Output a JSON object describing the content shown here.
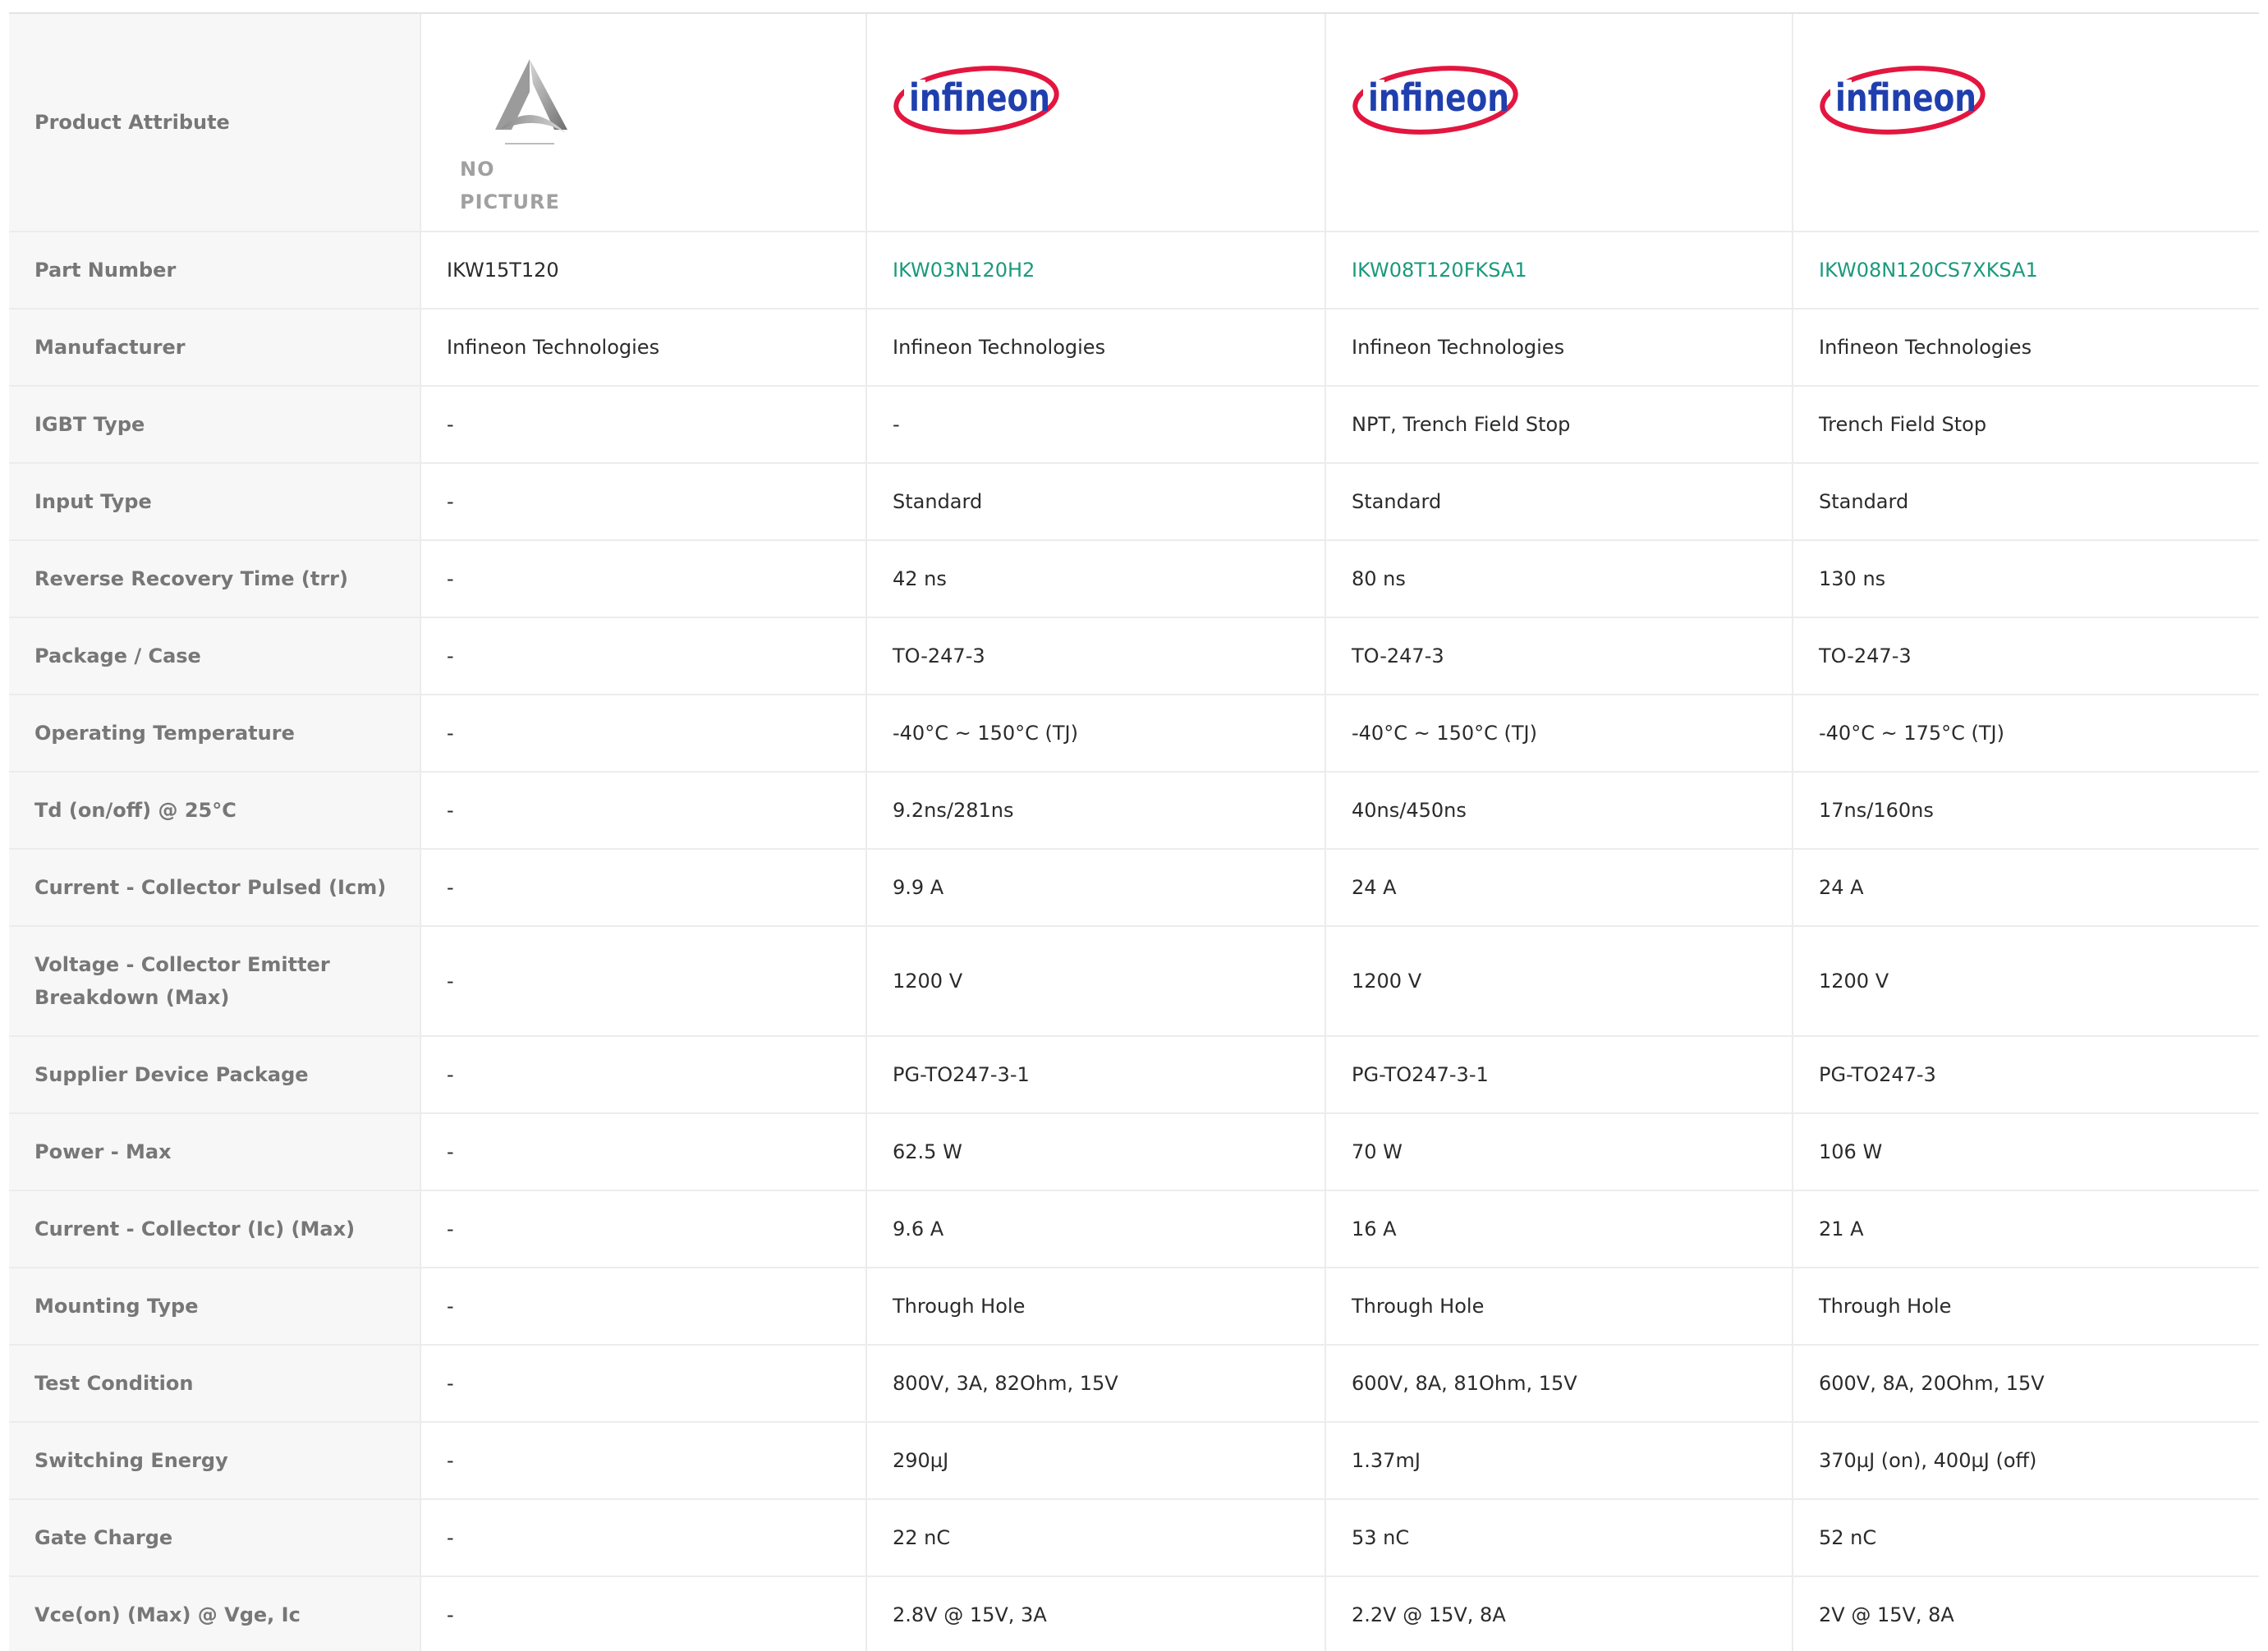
{
  "table": {
    "header_label": "Product Attribute",
    "no_picture_text": "NO PICTURE",
    "logo_text": "infineon",
    "columns": [
      {
        "image": "no-picture",
        "is_link": false
      },
      {
        "image": "infineon-logo",
        "is_link": true
      },
      {
        "image": "infineon-logo",
        "is_link": true
      },
      {
        "image": "infineon-logo",
        "is_link": true
      }
    ],
    "rows": [
      {
        "label": "Part Number",
        "values": [
          "IKW15T120",
          "IKW03N120H2",
          "IKW08T120FKSA1",
          "IKW08N120CS7XKSA1"
        ]
      },
      {
        "label": "Manufacturer",
        "values": [
          "Infineon Technologies",
          "Infineon Technologies",
          "Infineon Technologies",
          "Infineon Technologies"
        ]
      },
      {
        "label": "IGBT Type",
        "values": [
          "-",
          "-",
          "NPT, Trench Field Stop",
          "Trench Field Stop"
        ]
      },
      {
        "label": "Input Type",
        "values": [
          "-",
          "Standard",
          "Standard",
          "Standard"
        ]
      },
      {
        "label": "Reverse Recovery Time (trr)",
        "values": [
          "-",
          "42 ns",
          "80 ns",
          "130 ns"
        ]
      },
      {
        "label": "Package / Case",
        "values": [
          "-",
          "TO-247-3",
          "TO-247-3",
          "TO-247-3"
        ]
      },
      {
        "label": "Operating Temperature",
        "values": [
          "-",
          "-40°C ~ 150°C (TJ)",
          "-40°C ~ 150°C (TJ)",
          "-40°C ~ 175°C (TJ)"
        ]
      },
      {
        "label": "Td (on/off) @ 25°C",
        "values": [
          "-",
          "9.2ns/281ns",
          "40ns/450ns",
          "17ns/160ns"
        ]
      },
      {
        "label": "Current - Collector Pulsed (Icm)",
        "values": [
          "-",
          "9.9 A",
          "24 A",
          "24 A"
        ]
      },
      {
        "label": "Voltage - Collector Emitter Breakdown (Max)",
        "values": [
          "-",
          "1200 V",
          "1200 V",
          "1200 V"
        ]
      },
      {
        "label": "Supplier Device Package",
        "values": [
          "-",
          "PG-TO247-3-1",
          "PG-TO247-3-1",
          "PG-TO247-3"
        ]
      },
      {
        "label": "Power - Max",
        "values": [
          "-",
          "62.5 W",
          "70 W",
          "106 W"
        ]
      },
      {
        "label": "Current - Collector (Ic) (Max)",
        "values": [
          "-",
          "9.6 A",
          "16 A",
          "21 A"
        ]
      },
      {
        "label": "Mounting Type",
        "values": [
          "-",
          "Through Hole",
          "Through Hole",
          "Through Hole"
        ]
      },
      {
        "label": "Test Condition",
        "values": [
          "-",
          "800V, 3A, 82Ohm, 15V",
          "600V, 8A, 81Ohm, 15V",
          "600V, 8A, 20Ohm, 15V"
        ]
      },
      {
        "label": "Switching Energy",
        "values": [
          "-",
          "290µJ",
          "1.37mJ",
          "370µJ (on), 400µJ (off)"
        ]
      },
      {
        "label": "Gate Charge",
        "values": [
          "-",
          "22 nC",
          "53 nC",
          "52 nC"
        ]
      },
      {
        "label": "Vce(on) (Max) @ Vge, Ic",
        "values": [
          "-",
          "2.8V @ 15V, 3A",
          "2.2V @ 15V, 8A",
          "2V @ 15V, 8A"
        ]
      }
    ]
  },
  "colors": {
    "link": "#1a9a7c",
    "label": "#777777",
    "label_bg": "#f7f7f7",
    "logo_blue": "#1f3fae",
    "logo_red": "#e3163f"
  }
}
